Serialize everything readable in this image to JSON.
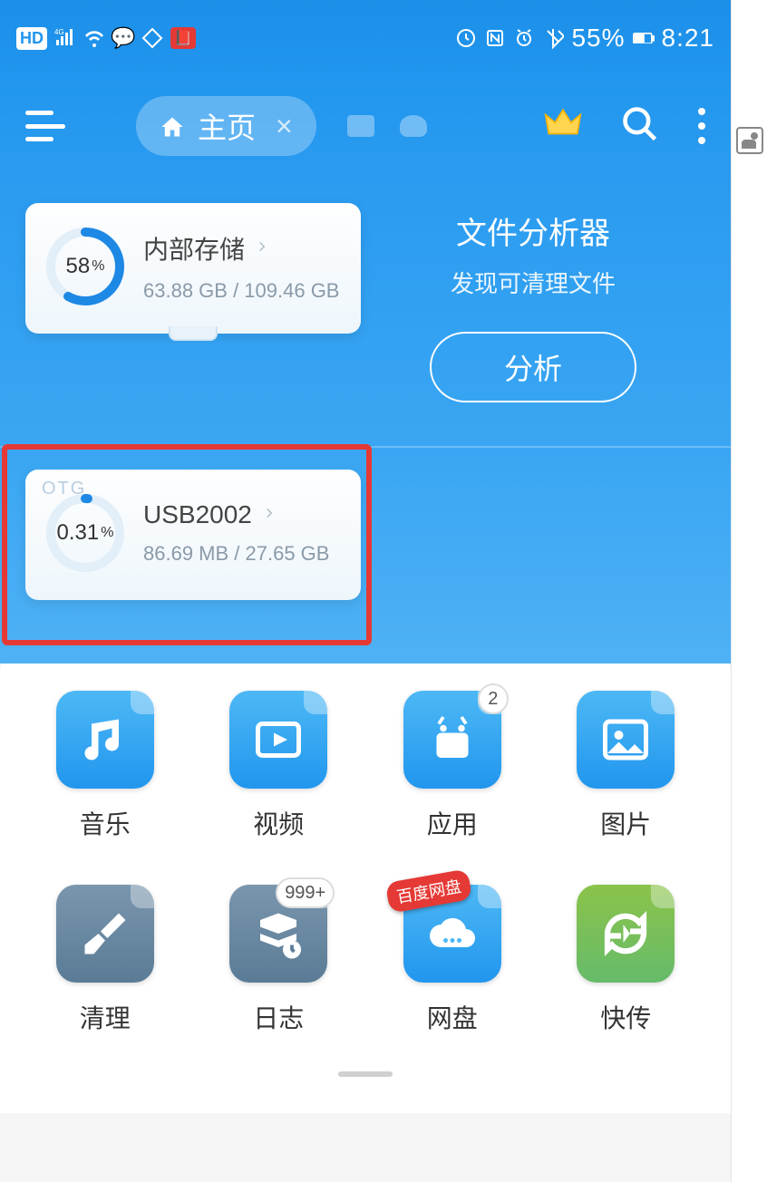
{
  "status": {
    "hd": "HD",
    "network": "4G",
    "battery": "55%",
    "time": "8:21",
    "book": "💬"
  },
  "header": {
    "tab_label": "主页"
  },
  "analyzer": {
    "title": "文件分析器",
    "subtitle": "发现可清理文件",
    "button": "分析"
  },
  "storage": [
    {
      "name": "内部存储",
      "percent": "58",
      "percent_unit": "%",
      "used": "63.88 GB / 109.46 GB",
      "otg": "",
      "ring_pct": 58
    },
    {
      "name": "USB2002",
      "percent": "0.31",
      "percent_unit": "%",
      "used": "86.69 MB / 27.65 GB",
      "otg": "OTG",
      "ring_pct": 1
    }
  ],
  "categories": [
    {
      "label": "音乐",
      "icon": "music",
      "color": "blue",
      "badge": ""
    },
    {
      "label": "视频",
      "icon": "video",
      "color": "blue",
      "badge": ""
    },
    {
      "label": "应用",
      "icon": "app",
      "color": "blue",
      "badge": "2"
    },
    {
      "label": "图片",
      "icon": "image",
      "color": "blue",
      "badge": ""
    },
    {
      "label": "清理",
      "icon": "broom",
      "color": "steel",
      "badge": ""
    },
    {
      "label": "日志",
      "icon": "log",
      "color": "steel",
      "badge": "999+"
    },
    {
      "label": "网盘",
      "icon": "cloud",
      "color": "blue",
      "badge": "",
      "red_badge": "百度网盘"
    },
    {
      "label": "快传",
      "icon": "transfer",
      "color": "green",
      "badge": ""
    }
  ]
}
